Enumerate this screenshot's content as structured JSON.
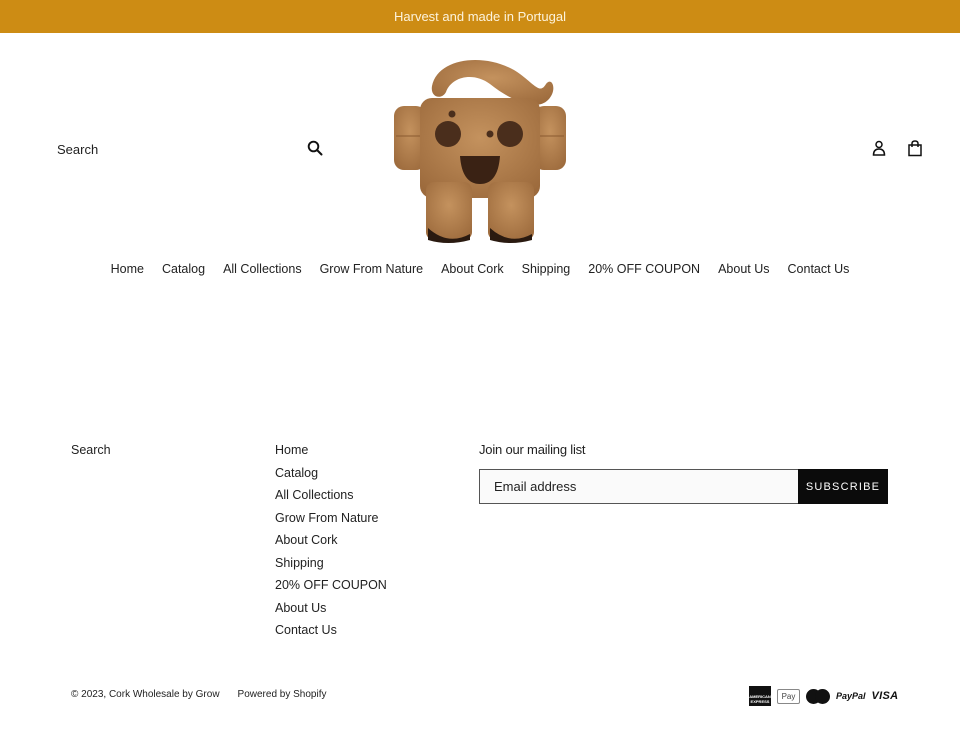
{
  "announcement": {
    "text": "Harvest and made in Portugal",
    "bg_color": "#cd8c14"
  },
  "header": {
    "search": {
      "placeholder": "Search",
      "button_icon": "search-icon"
    },
    "logo": {
      "alt": "Cork Wholesale by Grow"
    },
    "icons": [
      {
        "name": "account-icon",
        "label": "Log in"
      },
      {
        "name": "cart-icon",
        "label": "Cart"
      }
    ]
  },
  "nav": {
    "items": [
      {
        "label": "Home"
      },
      {
        "label": "Catalog"
      },
      {
        "label": "All Collections"
      },
      {
        "label": "Grow From Nature"
      },
      {
        "label": "About Cork"
      },
      {
        "label": "Shipping"
      },
      {
        "label": "20% OFF COUPON"
      },
      {
        "label": "About Us"
      },
      {
        "label": "Contact Us"
      }
    ]
  },
  "footer": {
    "search_label": "Search",
    "links": [
      {
        "label": "Home"
      },
      {
        "label": "Catalog"
      },
      {
        "label": "All Collections"
      },
      {
        "label": "Grow From Nature"
      },
      {
        "label": "About Cork"
      },
      {
        "label": "Shipping"
      },
      {
        "label": "20% OFF COUPON"
      },
      {
        "label": "About Us"
      },
      {
        "label": "Contact Us"
      }
    ],
    "newsletter": {
      "title": "Join our mailing list",
      "email_placeholder": "Email address",
      "subscribe_label": "SUBSCRIBE"
    },
    "copyright": "© 2023, Cork Wholesale by Grow",
    "powered_by": "Powered by Shopify",
    "payment_methods": [
      {
        "name": "American Express",
        "short": "AMERICAN EXPRESS"
      },
      {
        "name": "Apple Pay",
        "short": "Pay"
      },
      {
        "name": "Mastercard",
        "short": "mastercard"
      },
      {
        "name": "PayPal",
        "short": "PayPal"
      },
      {
        "name": "Visa",
        "short": "VISA"
      }
    ]
  }
}
